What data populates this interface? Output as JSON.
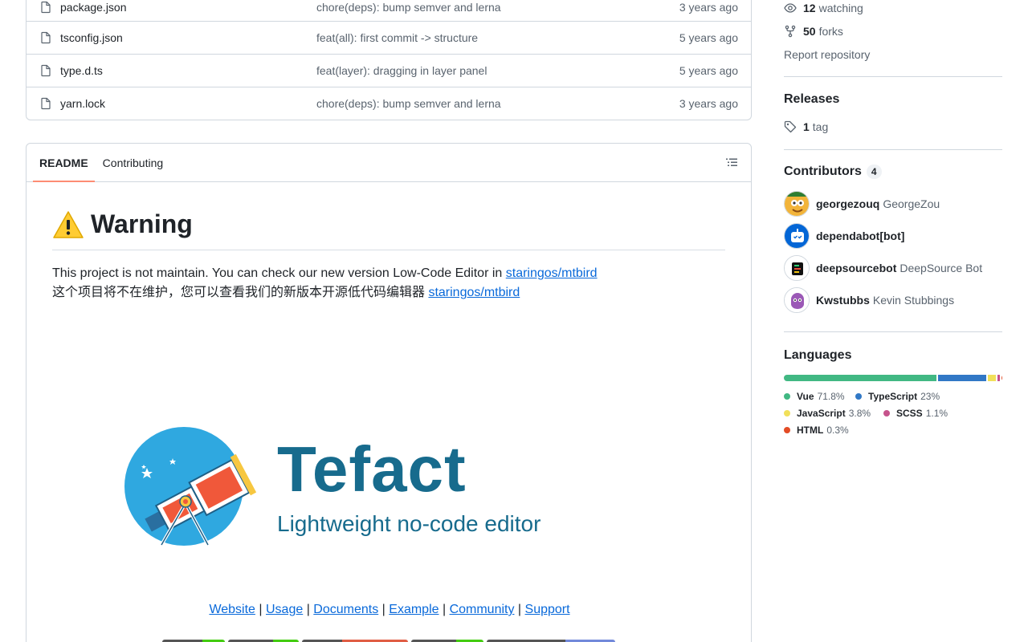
{
  "files": [
    {
      "name": "package.json",
      "message": "chore(deps): bump semver and lerna",
      "age": "3 years ago"
    },
    {
      "name": "tsconfig.json",
      "message": "feat(all): first commit -> structure",
      "age": "5 years ago"
    },
    {
      "name": "type.d.ts",
      "message": "feat(layer): dragging in layer panel",
      "age": "5 years ago"
    },
    {
      "name": "yarn.lock",
      "message": "chore(deps): bump semver and lerna",
      "age": "3 years ago"
    }
  ],
  "readme": {
    "tabs": [
      "README",
      "Contributing"
    ],
    "warning_emoji": "⚠️",
    "heading": "Warning",
    "line1_text": "This project is not maintain. You can check our new version Low-Code Editor in ",
    "line1_link": "staringos/mtbird",
    "line2_text": "这个项目将不在维护，您可以查看我们的新版本开源低代码编辑器 ",
    "line2_link": "staringos/mtbird",
    "logo_title": "Tefact",
    "logo_subtitle": "Lightweight no-code editor",
    "links": [
      "Website",
      "Usage",
      "Documents",
      "Example",
      "Community",
      "Support"
    ],
    "separator": " | "
  },
  "sidebar": {
    "watching_count": "12",
    "watching_label": "watching",
    "forks_count": "50",
    "forks_label": "forks",
    "report": "Report repository",
    "releases_title": "Releases",
    "tags_count": "1",
    "tags_label": "tag",
    "contributors_title": "Contributors",
    "contributors_count": "4",
    "contributors": [
      {
        "login": "georgezouq",
        "name": "GeorgeZou"
      },
      {
        "login": "dependabot[bot]",
        "name": ""
      },
      {
        "login": "deepsourcebot",
        "name": "DeepSource Bot"
      },
      {
        "login": "Kwstubbs",
        "name": "Kevin Stubbings"
      }
    ],
    "languages_title": "Languages",
    "languages": [
      {
        "name": "Vue",
        "pct": "71.8%",
        "value": 71.8,
        "color": "#41b883"
      },
      {
        "name": "TypeScript",
        "pct": "23%",
        "value": 23,
        "color": "#3178c6"
      },
      {
        "name": "JavaScript",
        "pct": "3.8%",
        "value": 3.8,
        "color": "#f1e05a"
      },
      {
        "name": "SCSS",
        "pct": "1.1%",
        "value": 1.1,
        "color": "#c6538c"
      },
      {
        "name": "HTML",
        "pct": "0.3%",
        "value": 0.3,
        "color": "#e34c26"
      }
    ]
  }
}
